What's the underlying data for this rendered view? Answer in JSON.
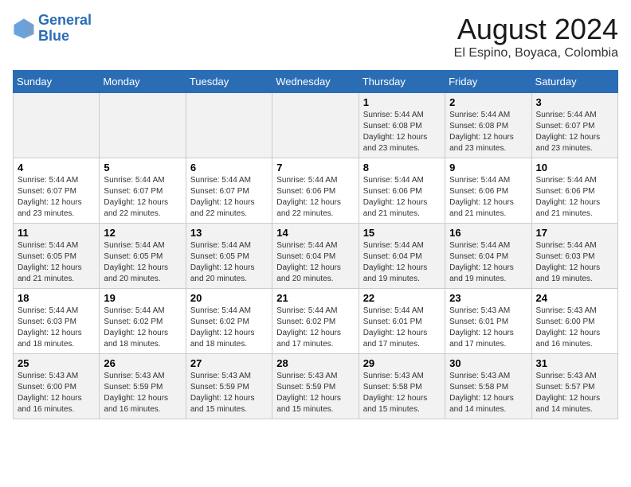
{
  "logo": {
    "line1": "General",
    "line2": "Blue"
  },
  "title": "August 2024",
  "subtitle": "El Espino, Boyaca, Colombia",
  "days_of_week": [
    "Sunday",
    "Monday",
    "Tuesday",
    "Wednesday",
    "Thursday",
    "Friday",
    "Saturday"
  ],
  "weeks": [
    [
      {
        "day": "",
        "info": ""
      },
      {
        "day": "",
        "info": ""
      },
      {
        "day": "",
        "info": ""
      },
      {
        "day": "",
        "info": ""
      },
      {
        "day": "1",
        "info": "Sunrise: 5:44 AM\nSunset: 6:08 PM\nDaylight: 12 hours\nand 23 minutes."
      },
      {
        "day": "2",
        "info": "Sunrise: 5:44 AM\nSunset: 6:08 PM\nDaylight: 12 hours\nand 23 minutes."
      },
      {
        "day": "3",
        "info": "Sunrise: 5:44 AM\nSunset: 6:07 PM\nDaylight: 12 hours\nand 23 minutes."
      }
    ],
    [
      {
        "day": "4",
        "info": "Sunrise: 5:44 AM\nSunset: 6:07 PM\nDaylight: 12 hours\nand 23 minutes."
      },
      {
        "day": "5",
        "info": "Sunrise: 5:44 AM\nSunset: 6:07 PM\nDaylight: 12 hours\nand 22 minutes."
      },
      {
        "day": "6",
        "info": "Sunrise: 5:44 AM\nSunset: 6:07 PM\nDaylight: 12 hours\nand 22 minutes."
      },
      {
        "day": "7",
        "info": "Sunrise: 5:44 AM\nSunset: 6:06 PM\nDaylight: 12 hours\nand 22 minutes."
      },
      {
        "day": "8",
        "info": "Sunrise: 5:44 AM\nSunset: 6:06 PM\nDaylight: 12 hours\nand 21 minutes."
      },
      {
        "day": "9",
        "info": "Sunrise: 5:44 AM\nSunset: 6:06 PM\nDaylight: 12 hours\nand 21 minutes."
      },
      {
        "day": "10",
        "info": "Sunrise: 5:44 AM\nSunset: 6:06 PM\nDaylight: 12 hours\nand 21 minutes."
      }
    ],
    [
      {
        "day": "11",
        "info": "Sunrise: 5:44 AM\nSunset: 6:05 PM\nDaylight: 12 hours\nand 21 minutes."
      },
      {
        "day": "12",
        "info": "Sunrise: 5:44 AM\nSunset: 6:05 PM\nDaylight: 12 hours\nand 20 minutes."
      },
      {
        "day": "13",
        "info": "Sunrise: 5:44 AM\nSunset: 6:05 PM\nDaylight: 12 hours\nand 20 minutes."
      },
      {
        "day": "14",
        "info": "Sunrise: 5:44 AM\nSunset: 6:04 PM\nDaylight: 12 hours\nand 20 minutes."
      },
      {
        "day": "15",
        "info": "Sunrise: 5:44 AM\nSunset: 6:04 PM\nDaylight: 12 hours\nand 19 minutes."
      },
      {
        "day": "16",
        "info": "Sunrise: 5:44 AM\nSunset: 6:04 PM\nDaylight: 12 hours\nand 19 minutes."
      },
      {
        "day": "17",
        "info": "Sunrise: 5:44 AM\nSunset: 6:03 PM\nDaylight: 12 hours\nand 19 minutes."
      }
    ],
    [
      {
        "day": "18",
        "info": "Sunrise: 5:44 AM\nSunset: 6:03 PM\nDaylight: 12 hours\nand 18 minutes."
      },
      {
        "day": "19",
        "info": "Sunrise: 5:44 AM\nSunset: 6:02 PM\nDaylight: 12 hours\nand 18 minutes."
      },
      {
        "day": "20",
        "info": "Sunrise: 5:44 AM\nSunset: 6:02 PM\nDaylight: 12 hours\nand 18 minutes."
      },
      {
        "day": "21",
        "info": "Sunrise: 5:44 AM\nSunset: 6:02 PM\nDaylight: 12 hours\nand 17 minutes."
      },
      {
        "day": "22",
        "info": "Sunrise: 5:44 AM\nSunset: 6:01 PM\nDaylight: 12 hours\nand 17 minutes."
      },
      {
        "day": "23",
        "info": "Sunrise: 5:43 AM\nSunset: 6:01 PM\nDaylight: 12 hours\nand 17 minutes."
      },
      {
        "day": "24",
        "info": "Sunrise: 5:43 AM\nSunset: 6:00 PM\nDaylight: 12 hours\nand 16 minutes."
      }
    ],
    [
      {
        "day": "25",
        "info": "Sunrise: 5:43 AM\nSunset: 6:00 PM\nDaylight: 12 hours\nand 16 minutes."
      },
      {
        "day": "26",
        "info": "Sunrise: 5:43 AM\nSunset: 5:59 PM\nDaylight: 12 hours\nand 16 minutes."
      },
      {
        "day": "27",
        "info": "Sunrise: 5:43 AM\nSunset: 5:59 PM\nDaylight: 12 hours\nand 15 minutes."
      },
      {
        "day": "28",
        "info": "Sunrise: 5:43 AM\nSunset: 5:59 PM\nDaylight: 12 hours\nand 15 minutes."
      },
      {
        "day": "29",
        "info": "Sunrise: 5:43 AM\nSunset: 5:58 PM\nDaylight: 12 hours\nand 15 minutes."
      },
      {
        "day": "30",
        "info": "Sunrise: 5:43 AM\nSunset: 5:58 PM\nDaylight: 12 hours\nand 14 minutes."
      },
      {
        "day": "31",
        "info": "Sunrise: 5:43 AM\nSunset: 5:57 PM\nDaylight: 12 hours\nand 14 minutes."
      }
    ]
  ]
}
